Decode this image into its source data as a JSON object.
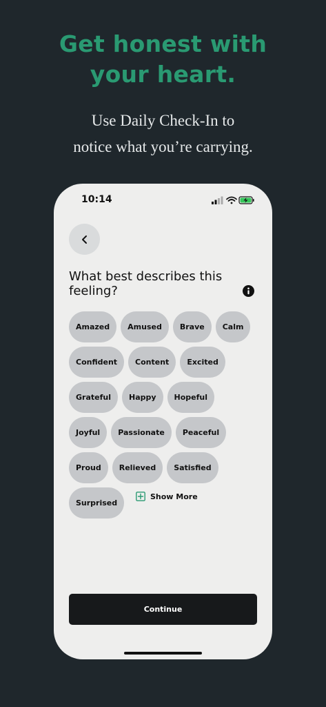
{
  "headline": {
    "line1": "Get honest with",
    "line2": "your heart."
  },
  "subhead": {
    "line1": "Use Daily Check-In to",
    "line2": "notice what you’re carrying."
  },
  "status_bar": {
    "time": "10:14",
    "icons": [
      "cellular-signal-icon",
      "wifi-icon",
      "battery-charging-icon"
    ]
  },
  "screen": {
    "back_icon": "chevron-left-icon",
    "question": "What best describes this feeling?",
    "info_icon": "info-icon",
    "chips": [
      {
        "label": "Amazed"
      },
      {
        "label": "Amused"
      },
      {
        "label": "Brave"
      },
      {
        "label": "Calm"
      },
      {
        "label": "Confident"
      },
      {
        "label": "Content"
      },
      {
        "label": "Excited"
      },
      {
        "label": "Grateful"
      },
      {
        "label": "Happy"
      },
      {
        "label": "Hopeful"
      },
      {
        "label": "Joyful"
      },
      {
        "label": "Passionate"
      },
      {
        "label": "Peaceful"
      },
      {
        "label": "Proud"
      },
      {
        "label": "Relieved"
      },
      {
        "label": "Satisfied"
      },
      {
        "label": "Surprised"
      }
    ],
    "show_more_label": "Show More",
    "continue_label": "Continue"
  },
  "colors": {
    "background": "#1f272c",
    "accent_green": "#2a9a72",
    "phone_screen": "#eeeeed",
    "chip": "#c5c7ca",
    "button": "#17191b"
  }
}
